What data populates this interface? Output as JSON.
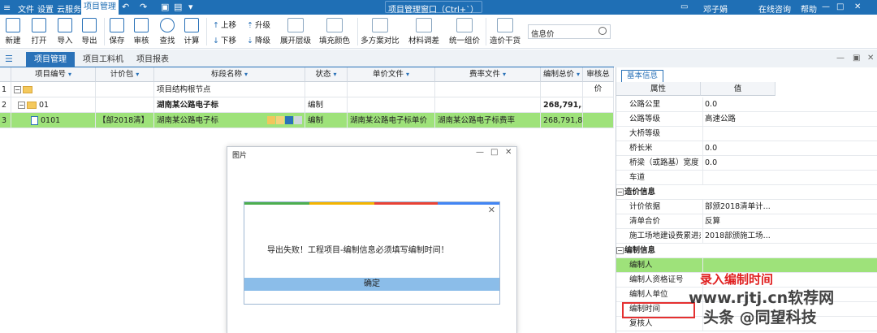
{
  "menu": {
    "items": [
      "文件",
      "设置",
      "云服务"
    ],
    "active": "项目管理",
    "window_title": "项目管理窗口（Ctrl+`）",
    "right": [
      "在线咨询",
      "帮助"
    ],
    "user": "邓子娟"
  },
  "ribbon": {
    "buttons": [
      "新建",
      "打开",
      "导入",
      "导出",
      "保存",
      "审核",
      "查找",
      "计算"
    ],
    "up": "上移",
    "down": "下移",
    "promote": "升级",
    "demote": "降级",
    "expand": "展开层级",
    "fill": "填充颜色",
    "compare": "多方案对比",
    "material": "材料调差",
    "unify": "统一组价",
    "cost": "造价干货",
    "search_value": "信息价"
  },
  "tabs": [
    "项目管理",
    "项目工料机",
    "项目报表"
  ],
  "table": {
    "headers": [
      "项目编号",
      "计价包",
      "标段名称",
      "状态",
      "单价文件",
      "费率文件",
      "编制总价",
      "审核总价"
    ],
    "rows": [
      {
        "num": "1",
        "code": "",
        "pkg": "",
        "name": "项目结构根节点",
        "status": "",
        "price_file": "",
        "rate_file": "",
        "total": "",
        "audit": ""
      },
      {
        "num": "2",
        "code": "01",
        "pkg": "",
        "name": "湖南某公路电子标",
        "status": "编制",
        "price_file": "",
        "rate_file": "",
        "total": "268,791,...",
        "audit": ""
      },
      {
        "num": "3",
        "code": "0101",
        "pkg": "【部2018清】",
        "name": "湖南某公路电子标",
        "status": "编制",
        "price_file": "湖南某公路电子标单价",
        "rate_file": "湖南某公路电子标费率",
        "total": "268,791,8...",
        "audit": ""
      }
    ]
  },
  "dialog": {
    "title": "图片",
    "message": "导出失败！工程项目-编制信息必须填写编制时间！",
    "ok": "确定"
  },
  "panel": {
    "tab": "基本信息",
    "headers": [
      "属性",
      "值"
    ],
    "rows": [
      {
        "k": "公路公里",
        "v": "0.0"
      },
      {
        "k": "公路等级",
        "v": "高速公路"
      },
      {
        "k": "大桥等级",
        "v": ""
      },
      {
        "k": "桥长米",
        "v": "0.0"
      },
      {
        "k": "桥梁（或路基）宽度",
        "v": "0.0"
      },
      {
        "k": "车道",
        "v": ""
      },
      {
        "k": "造价信息",
        "v": "",
        "group": true
      },
      {
        "k": "计价依据",
        "v": "部颁2018清单计..."
      },
      {
        "k": "清单合价",
        "v": "反算"
      },
      {
        "k": "施工场地建设费累进办法",
        "v": "2018部颁施工场..."
      },
      {
        "k": "编制信息",
        "v": "",
        "group": true
      },
      {
        "k": "编制人",
        "v": "",
        "highlight": true
      },
      {
        "k": "编制人资格证号",
        "v": ""
      },
      {
        "k": "编制人单位",
        "v": ""
      },
      {
        "k": "编制时间",
        "v": ""
      },
      {
        "k": "复核人",
        "v": ""
      }
    ]
  },
  "annotation": "录入编制时间",
  "watermark": {
    "line1": "www.rjtj.cn软荐网",
    "line2": "头条 @同望科技"
  },
  "colors": {
    "primary": "#1f6fb5",
    "selected_row": "#9ee27a",
    "annotation": "#e02020"
  }
}
